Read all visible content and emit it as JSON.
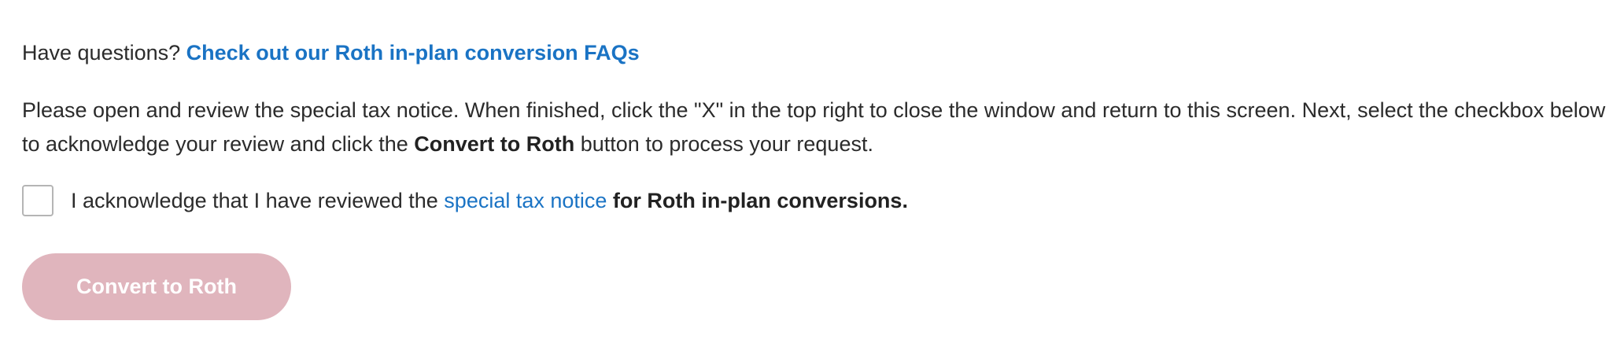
{
  "faq": {
    "prefix": "Have questions?",
    "link_label": "Check out our Roth in-plan conversion FAQs"
  },
  "instructions": {
    "part1": "Please open and review the special tax notice. When finished, click the \"X\" in the top right to close the window and return to this screen. Next, select the checkbox below to acknowledge your review and click the ",
    "bold": "Convert to Roth",
    "part2": " button to process your request."
  },
  "acknowledge": {
    "checked": false,
    "prefix": "I acknowledge that I have reviewed the ",
    "link_label": "special tax notice",
    "suffix": " for Roth in-plan conversions."
  },
  "convert_button": {
    "label": "Convert to Roth",
    "disabled": true
  },
  "colors": {
    "link": "#1a73c4",
    "button_disabled_bg": "#e0b5bd",
    "text": "#2b2b2b"
  }
}
